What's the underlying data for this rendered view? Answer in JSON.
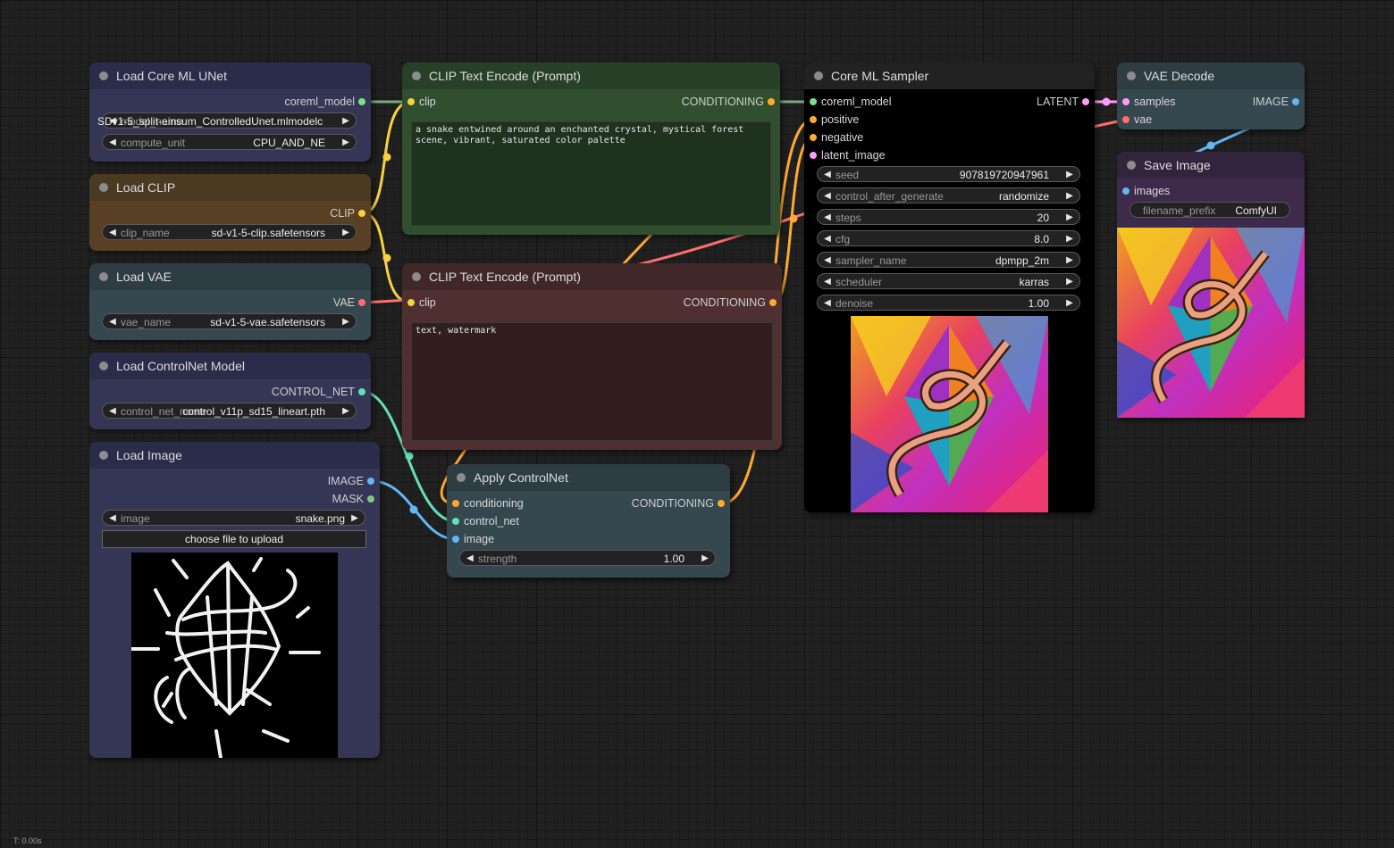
{
  "colors": {
    "canvas_bg": "#202020",
    "node_default_title": "#2b2b4a",
    "node_default_body": "#353555",
    "slot_model": "#7fe08c",
    "slot_clip": "#f8d13d",
    "slot_vae": "#ff6e6e",
    "slot_conditioning": "#ffa931",
    "slot_latent": "#ff9cf9",
    "slot_image": "#64b5f6",
    "slot_mask": "#81c784",
    "slot_control_net": "#64dfb4"
  },
  "nodes": {
    "load_unet": {
      "title": "Load Core ML UNet",
      "output": "coreml_model",
      "widgets": [
        {
          "label": "model_name",
          "value": "SDv1-5_split-einsum_ControlledUnet.mlmodelc"
        },
        {
          "label": "compute_unit",
          "value": "CPU_AND_NE"
        }
      ]
    },
    "load_clip": {
      "title": "Load CLIP",
      "output": "CLIP",
      "widgets": [
        {
          "label": "clip_name",
          "value": "sd-v1-5-clip.safetensors"
        }
      ]
    },
    "load_vae": {
      "title": "Load VAE",
      "output": "VAE",
      "widgets": [
        {
          "label": "vae_name",
          "value": "sd-v1-5-vae.safetensors"
        }
      ]
    },
    "load_controlnet": {
      "title": "Load ControlNet Model",
      "output": "CONTROL_NET",
      "widgets": [
        {
          "label": "control_net_name",
          "value": "control_v11p_sd15_lineart.pth"
        }
      ]
    },
    "load_image": {
      "title": "Load Image",
      "outputs": [
        "IMAGE",
        "MASK"
      ],
      "widgets": [
        {
          "label": "image",
          "value": "snake.png"
        }
      ],
      "upload_button": "choose file to upload"
    },
    "clip_pos": {
      "title": "CLIP Text Encode (Prompt)",
      "input": "clip",
      "output": "CONDITIONING",
      "text": "a snake entwined around an enchanted crystal, mystical forest scene, vibrant, saturated color palette"
    },
    "clip_neg": {
      "title": "CLIP Text Encode (Prompt)",
      "input": "clip",
      "output": "CONDITIONING",
      "text": "text, watermark"
    },
    "apply_controlnet": {
      "title": "Apply ControlNet",
      "inputs": [
        "conditioning",
        "control_net",
        "image"
      ],
      "output": "CONDITIONING",
      "widgets": [
        {
          "label": "strength",
          "value": "1.00"
        }
      ]
    },
    "sampler": {
      "title": "Core ML Sampler",
      "inputs": [
        "coreml_model",
        "positive",
        "negative",
        "latent_image"
      ],
      "output": "LATENT",
      "widgets": [
        {
          "label": "seed",
          "value": "907819720947961"
        },
        {
          "label": "control_after_generate",
          "value": "randomize"
        },
        {
          "label": "steps",
          "value": "20"
        },
        {
          "label": "cfg",
          "value": "8.0"
        },
        {
          "label": "sampler_name",
          "value": "dpmpp_2m"
        },
        {
          "label": "scheduler",
          "value": "karras"
        },
        {
          "label": "denoise",
          "value": "1.00"
        }
      ]
    },
    "vae_decode": {
      "title": "VAE Decode",
      "inputs": [
        "samples",
        "vae"
      ],
      "output": "IMAGE"
    },
    "save_image": {
      "title": "Save Image",
      "input": "images",
      "widgets": [
        {
          "label": "filename_prefix",
          "value": "ComfyUI"
        }
      ]
    }
  },
  "icons": {
    "arrow_left": "◀",
    "arrow_right": "▶"
  },
  "footer": "T: 0.00s"
}
